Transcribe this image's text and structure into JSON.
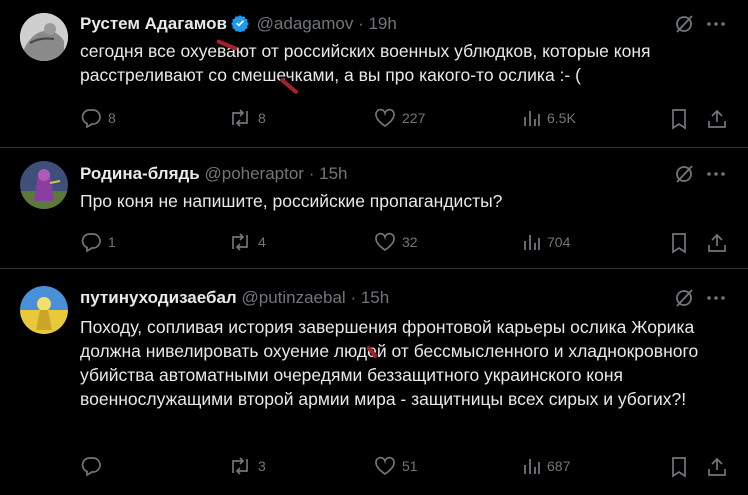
{
  "tweets": [
    {
      "name": "Рустем Адагамов",
      "handle": "@adagamov",
      "sep": "·",
      "time": "19h",
      "text": "сегодня все охуевают от российских военных ублюдков, которые коня расстреливают со смешечками, а вы про какого-то ослика :- (",
      "replies": "8",
      "reposts": "8",
      "likes": "227",
      "views": "6.5K"
    },
    {
      "name": "Родина-блядь",
      "handle": "@poheraptor",
      "sep": "·",
      "time": "15h",
      "text": "Про коня не напишите, российские пропагандисты?",
      "replies": "1",
      "reposts": "4",
      "likes": "32",
      "views": "704"
    },
    {
      "name": "путинуходизаебал",
      "handle": "@putinzaebal",
      "sep": "·",
      "time": "15h",
      "text": "Походу, сопливая история завершения фронтовой карьеры ослика Жорика должна нивелировать охуение людей от бессмысленного и хладнокровного убийства автоматными очередями беззащитного украинского коня военнослужащими второй армии мира - защитницы всех сирых и убогих?!",
      "replies": "",
      "reposts": "3",
      "likes": "51",
      "views": "687"
    }
  ],
  "colors": {
    "background": "#000000",
    "text": "#e7e9ea",
    "muted": "#71767b",
    "verified": "#1d9bf0",
    "divider": "#2f3336",
    "redaction_mark": "#a5202a"
  },
  "icons": [
    "grok-icon",
    "more-icon",
    "reply-icon",
    "repost-icon",
    "like-icon",
    "views-icon",
    "bookmark-icon",
    "share-icon",
    "verified-badge-icon"
  ]
}
